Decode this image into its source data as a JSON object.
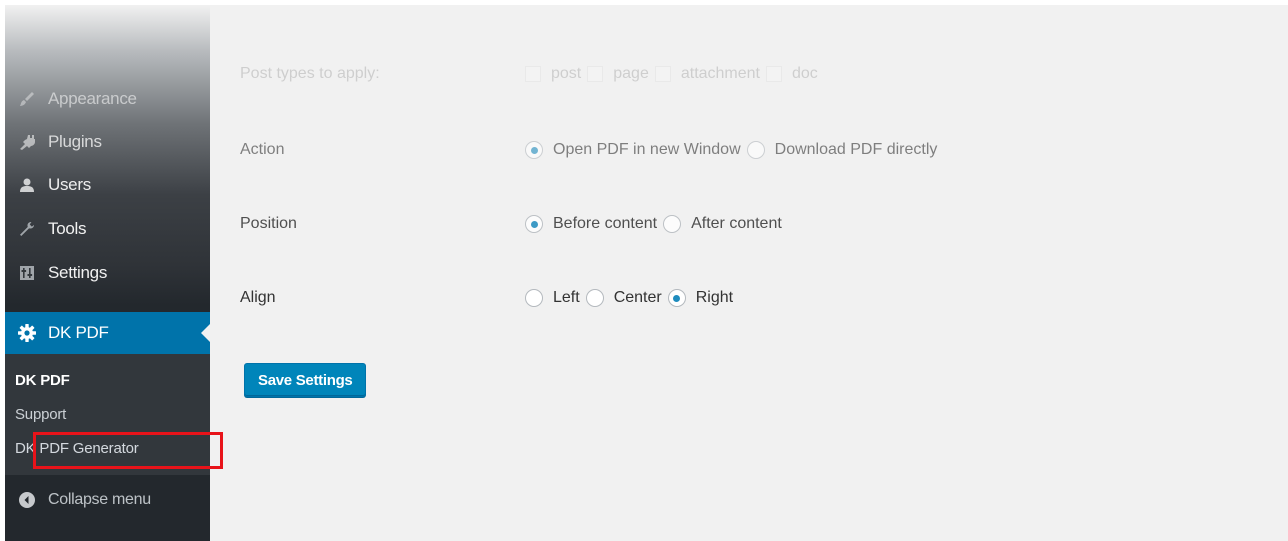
{
  "sidebar": {
    "items": [
      {
        "label": "Appearance",
        "icon": "paintbrush-icon"
      },
      {
        "label": "Plugins",
        "icon": "plug-icon"
      },
      {
        "label": "Users",
        "icon": "users-icon"
      },
      {
        "label": "Tools",
        "icon": "wrench-icon"
      },
      {
        "label": "Settings",
        "icon": "settings-icon"
      }
    ],
    "active": {
      "label": "DK PDF",
      "icon": "gear-icon"
    },
    "submenu": [
      "DK PDF",
      "Support",
      "DK PDF Generator"
    ],
    "collapse_label": "Collapse menu"
  },
  "settings": {
    "post_types": {
      "label": "Post types to apply:",
      "options": [
        "post",
        "page",
        "attachment",
        "doc"
      ]
    },
    "action": {
      "label": "Action",
      "options": [
        "Open PDF in new Window",
        "Download PDF directly"
      ],
      "selected": "Open PDF in new Window"
    },
    "position": {
      "label": "Position",
      "options": [
        "Before content",
        "After content"
      ],
      "selected": "Before content"
    },
    "align": {
      "label": "Align",
      "options": [
        "Left",
        "Center",
        "Right"
      ],
      "selected": "Right"
    }
  },
  "save_label": "Save Settings",
  "colors": {
    "accent": "#0073aa",
    "button": "#0085ba",
    "highlight": "#e8131a",
    "sidebar": "#23282d"
  }
}
